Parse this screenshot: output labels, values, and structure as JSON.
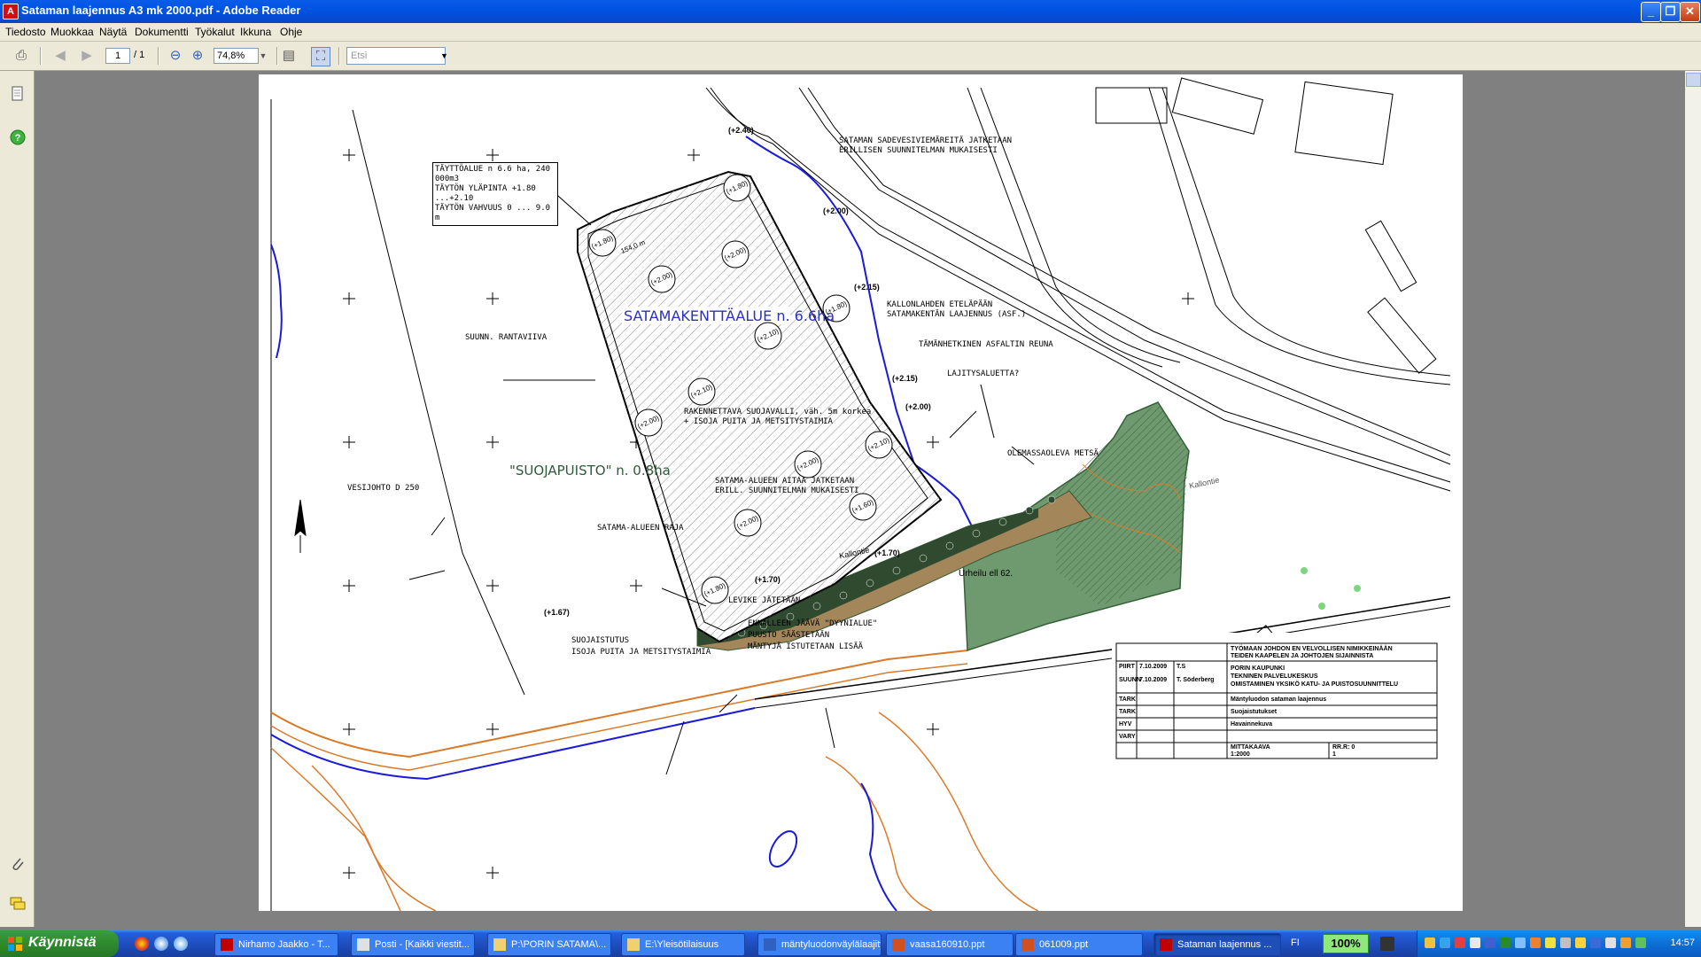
{
  "window": {
    "title": "Sataman laajennus A3 mk 2000.pdf - Adobe Reader",
    "buttons": {
      "minimize": "_",
      "maximize": "❐",
      "close": "✕"
    }
  },
  "menu": [
    "Tiedosto",
    "Muokkaa",
    "Näytä",
    "Dokumentti",
    "Työkalut",
    "Ikkuna",
    "Ohje"
  ],
  "toolbar": {
    "page_current": "1",
    "page_total": "/ 1",
    "zoom": "74,8%",
    "search_placeholder": "Etsi"
  },
  "map": {
    "fill_area": [
      "TÄYTTÖALUE n 6.6 ha, 240 000m3",
      "TÄYTÖN YLÄPINTA +1.80 ...+2.10",
      "TÄYTÖN VAHVUUS 0 ... 9.0 m"
    ],
    "stormwater": [
      "SATAMAN SADEVESIVIEMÄREITÄ JATKETAAN",
      "ERILLISEN SUUNNITELMAN MUKAISESTI"
    ],
    "harbour_field": "SATAMAKENTTÄALUE n. 6.6ha",
    "planned_shoreline": "SUUNN. RANTAVIIVA",
    "kallonlahti": [
      "KALLONLAHDEN ETELÄPÄÄN",
      "SATAMAKENTÄN LAAJENNUS (ASF.)"
    ],
    "asphalt_edge": "TÄMÄNHETKINEN ASFALTIN REUNA",
    "sorting_area": "LAJITYSALUETTA?",
    "embankment": [
      "RAKENNETTAVA SUOJAVALLI, väh. 5m korkea",
      "+ ISOJA PUITA JA METSITYSTAIMIA"
    ],
    "protection_park": "\"SUOJAPUISTO\" n. 0.8ha",
    "fence": [
      "SATAMA-ALUEEN AITAA JATKETAAN",
      "ERILL. SUUNNITELMAN MUKAISESTI"
    ],
    "existing_forest": "OLEMASSAOLEVA METSÄ",
    "water_pipe": "VESIJOHTO D 250",
    "harbour_boundary": "SATAMA-ALUEEN RAJA",
    "widening": "LEVIKE JÄTETÄÄN",
    "dune": [
      "ENNALLEEN JÄÄVÄ \"DYYNIALUE\"",
      "PUUSTO SÄÄSTETÄÄN",
      "MÄNTYJÄ ISTUTETAAN LISÄÄ"
    ],
    "screening": [
      "SUOJAISTUTUS",
      "ISOJA PUITA JA METSITYSTAIMIA"
    ],
    "road": "Kallontie",
    "road2": "Kallontie",
    "sports": "Urheilu ell 62.",
    "dim_1540": "154,0 m",
    "levels": [
      "(+1.80)",
      "(+2.00)",
      "(+2.00)",
      "(+2.10)",
      "(+2.10)",
      "(+1.80)",
      "(+2.00)",
      "(+1.80)",
      "(+2.00)",
      "(+2.00)",
      "(+1.60)",
      "(+1.80)",
      "(+2.40)",
      "(+2.10)",
      "(+2.00)",
      "(+2.15)",
      "(+2.15)",
      "(+2.00)",
      "(+1.70)",
      "(+1.70)",
      "(+1.67)"
    ]
  },
  "titleblock": {
    "header1": "TYÖMAAN JOHDON EN VELVOLLISEN NIMIKKEINÄÄN",
    "header2": "TEIDEN KAAPELEN JA JOHTOJEN SIJAINNISTA",
    "city": "PORIN KAUPUNKI",
    "center": "TEKNINEN PALVELUKESKUS",
    "unit": "OMISTAMINEN YKSIKÖ KATU- JA PUISTOSUUNNITTELU",
    "rows": [
      {
        "label": "PIIRT",
        "date": "7.10.2009",
        "name": "T.S"
      },
      {
        "label": "SUUNN",
        "date": "7.10.2009",
        "name": "T. Söderberg"
      },
      {
        "label": "TARK",
        "date": "",
        "name": ""
      },
      {
        "label": "TARK",
        "date": "",
        "name": ""
      },
      {
        "label": "HYV",
        "date": "",
        "name": ""
      },
      {
        "label": "VARY",
        "date": "",
        "name": ""
      }
    ],
    "project": "Mäntyluodon sataman laajennus",
    "subject": "Suojaistutukset",
    "drawing": "Havainnekuva",
    "scale_label": "MITTAKAAVA",
    "scale": "1:2000",
    "rev_label": "RR.R: 0",
    "rev": "1"
  },
  "taskbar": {
    "start": "Käynnistä",
    "tasks": [
      {
        "label": "Nirhamo Jaakko - T...",
        "color": "#c00000"
      },
      {
        "label": "Posti - [Kaikki viestit...",
        "color": "#e0e0e0"
      },
      {
        "label": "P:\\PORIN SATAMA\\...",
        "color": "#f0d070"
      },
      {
        "label": "E:\\Yleisötilaisuus",
        "color": "#f0d070"
      },
      {
        "label": "mäntyluodonväylälaajitysY...",
        "color": "#3060c0"
      },
      {
        "label": "vaasa160910.ppt",
        "color": "#d05020"
      },
      {
        "label": "061009.ppt",
        "color": "#d05020"
      },
      {
        "label": "Sataman laajennus ...",
        "color": "#c00000"
      }
    ],
    "language": "FI",
    "zoom_badge": "100%",
    "clock": "14:57"
  }
}
